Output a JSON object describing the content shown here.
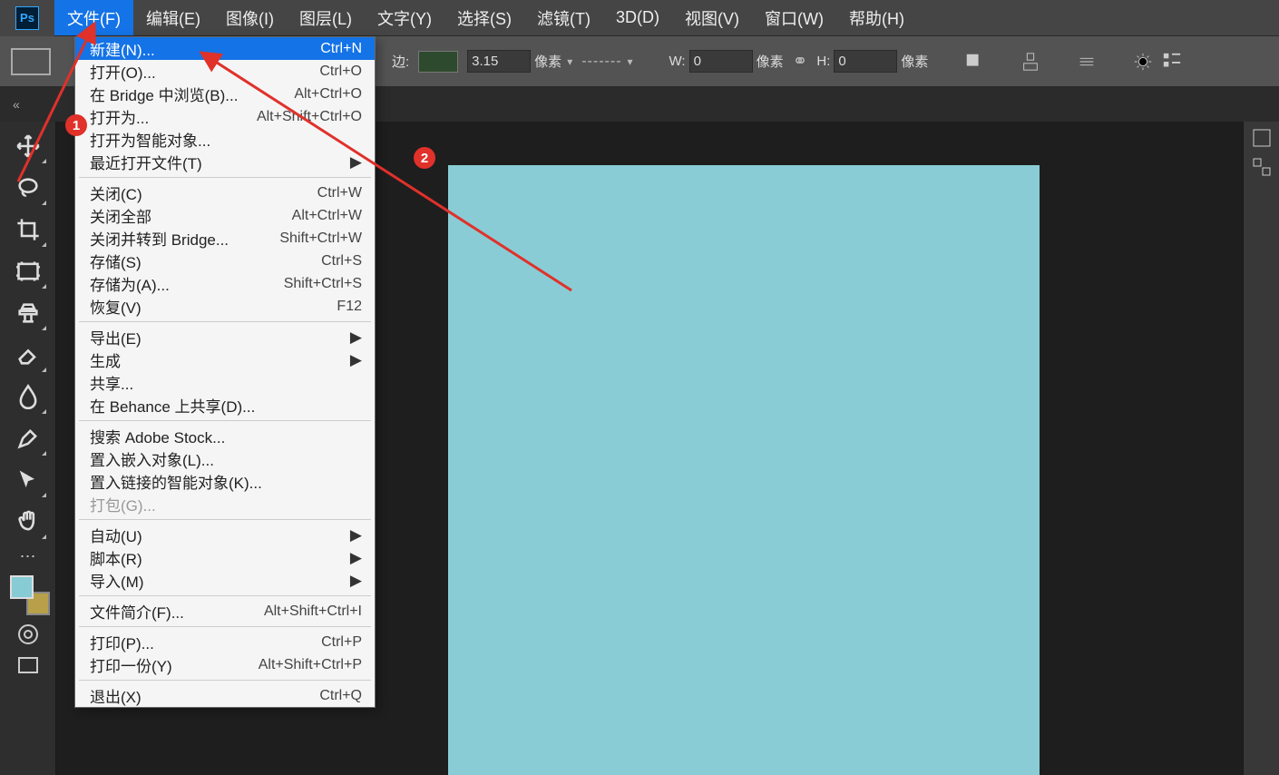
{
  "app": {
    "logo_text": "Ps"
  },
  "menubar": [
    "文件(F)",
    "编辑(E)",
    "图像(I)",
    "图层(L)",
    "文字(Y)",
    "选择(S)",
    "滤镜(T)",
    "3D(D)",
    "视图(V)",
    "窗口(W)",
    "帮助(H)"
  ],
  "options": {
    "stroke_value": "3.15",
    "stroke_unit": "像素",
    "width_prefix": "W:",
    "width_value": "0",
    "width_unit": "像素",
    "height_prefix": "H:",
    "height_value": "0",
    "height_unit": "像素",
    "side_label": "边:"
  },
  "tabrow": {
    "expand_char": "«"
  },
  "toolbox": {
    "fg_color": "#87cbd4",
    "bg_color": "#b8a04a"
  },
  "canvas": {
    "color": "#89ccd5"
  },
  "file_menu": {
    "items": [
      {
        "label": "新建(N)...",
        "shortcut": "Ctrl+N",
        "highlight": true
      },
      {
        "label": "打开(O)...",
        "shortcut": "Ctrl+O"
      },
      {
        "label": "在 Bridge 中浏览(B)...",
        "shortcut": "Alt+Ctrl+O"
      },
      {
        "label": "打开为...",
        "shortcut": "Alt+Shift+Ctrl+O"
      },
      {
        "label": "打开为智能对象..."
      },
      {
        "label": "最近打开文件(T)",
        "submenu": true
      },
      {
        "sep": true
      },
      {
        "label": "关闭(C)",
        "shortcut": "Ctrl+W"
      },
      {
        "label": "关闭全部",
        "shortcut": "Alt+Ctrl+W"
      },
      {
        "label": "关闭并转到 Bridge...",
        "shortcut": "Shift+Ctrl+W"
      },
      {
        "label": "存储(S)",
        "shortcut": "Ctrl+S"
      },
      {
        "label": "存储为(A)...",
        "shortcut": "Shift+Ctrl+S"
      },
      {
        "label": "恢复(V)",
        "shortcut": "F12"
      },
      {
        "sep": true
      },
      {
        "label": "导出(E)",
        "submenu": true
      },
      {
        "label": "生成",
        "submenu": true
      },
      {
        "label": "共享..."
      },
      {
        "label": "在 Behance 上共享(D)..."
      },
      {
        "sep": true
      },
      {
        "label": "搜索 Adobe Stock..."
      },
      {
        "label": "置入嵌入对象(L)..."
      },
      {
        "label": "置入链接的智能对象(K)..."
      },
      {
        "label": "打包(G)...",
        "disabled": true
      },
      {
        "sep": true
      },
      {
        "label": "自动(U)",
        "submenu": true
      },
      {
        "label": "脚本(R)",
        "submenu": true
      },
      {
        "label": "导入(M)",
        "submenu": true
      },
      {
        "sep": true
      },
      {
        "label": "文件简介(F)...",
        "shortcut": "Alt+Shift+Ctrl+I"
      },
      {
        "sep": true
      },
      {
        "label": "打印(P)...",
        "shortcut": "Ctrl+P"
      },
      {
        "label": "打印一份(Y)",
        "shortcut": "Alt+Shift+Ctrl+P"
      },
      {
        "sep": true
      },
      {
        "label": "退出(X)",
        "shortcut": "Ctrl+Q"
      }
    ]
  },
  "annotations": {
    "badge1": "1",
    "badge2": "2"
  }
}
